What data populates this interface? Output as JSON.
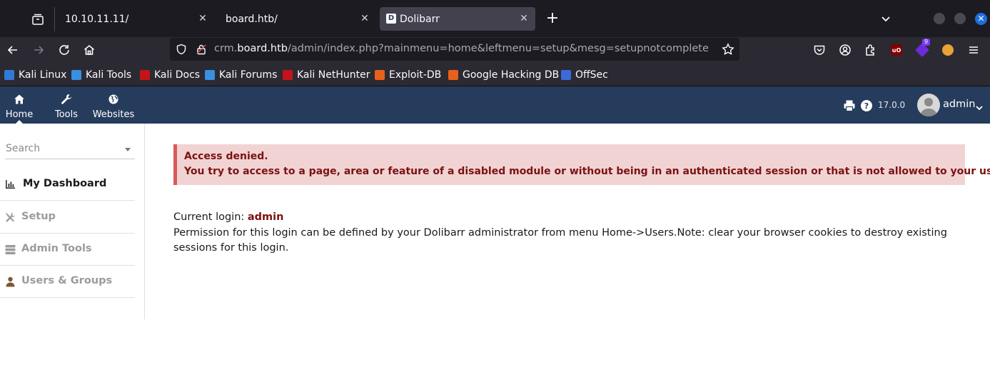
{
  "browser": {
    "tabs": [
      {
        "title": "10.10.11.11/",
        "active": false
      },
      {
        "title": "board.htb/",
        "active": false
      },
      {
        "title": "Dolibarr",
        "active": true,
        "favicon": "D"
      }
    ],
    "url": {
      "prefix": "crm.",
      "host": "board.htb",
      "path": "/admin/index.php?mainmenu=home&leftmenu=setup&mesg=setupnotcomplete"
    },
    "extension_badge": "9",
    "ublock_label": "uO",
    "bookmarks": [
      {
        "label": "Kali Linux",
        "icon_color": "#2f7ad6"
      },
      {
        "label": "Kali Tools",
        "icon_color": "#3a8fe0"
      },
      {
        "label": "Kali Docs",
        "icon_color": "#c2141a"
      },
      {
        "label": "Kali Forums",
        "icon_color": "#3a8fe0"
      },
      {
        "label": "Kali NetHunter",
        "icon_color": "#c2141a"
      },
      {
        "label": "Exploit-DB",
        "icon_color": "#e8601c"
      },
      {
        "label": "Google Hacking DB",
        "icon_color": "#e8601c"
      },
      {
        "label": "OffSec",
        "icon_color": "#3c6bd8"
      }
    ]
  },
  "dolibarr": {
    "top_menu": [
      {
        "label": "Home",
        "icon": "home-icon",
        "active": true
      },
      {
        "label": "Tools",
        "icon": "wrench-icon",
        "active": false
      },
      {
        "label": "Websites",
        "icon": "globe-icon",
        "active": false
      }
    ],
    "version": "17.0.0",
    "user": "admin",
    "colors": {
      "topbar": "#263c5c",
      "error_bg": "#f2d3d3",
      "error_text": "#7a1212"
    }
  },
  "left_menu": {
    "search_placeholder": "Search",
    "items": [
      {
        "label": "My Dashboard",
        "icon": "chart-icon",
        "active": true
      },
      {
        "label": "Setup",
        "icon": "tools-icon",
        "active": false
      },
      {
        "label": "Admin Tools",
        "icon": "server-icon",
        "active": false
      },
      {
        "label": "Users & Groups",
        "icon": "user-icon",
        "active": false
      }
    ]
  },
  "main": {
    "error_title": "Access denied.",
    "error_message": "You try to access to a page, area or feature of a disabled module or without being in an authenticated session or that is not allowed to your user.",
    "current_login_label": "Current login: ",
    "current_login_user": "admin",
    "permission_text": "Permission for this login can be defined by your Dolibarr administrator from menu Home->Users.Note: clear your browser cookies to destroy existing sessions for this login."
  }
}
